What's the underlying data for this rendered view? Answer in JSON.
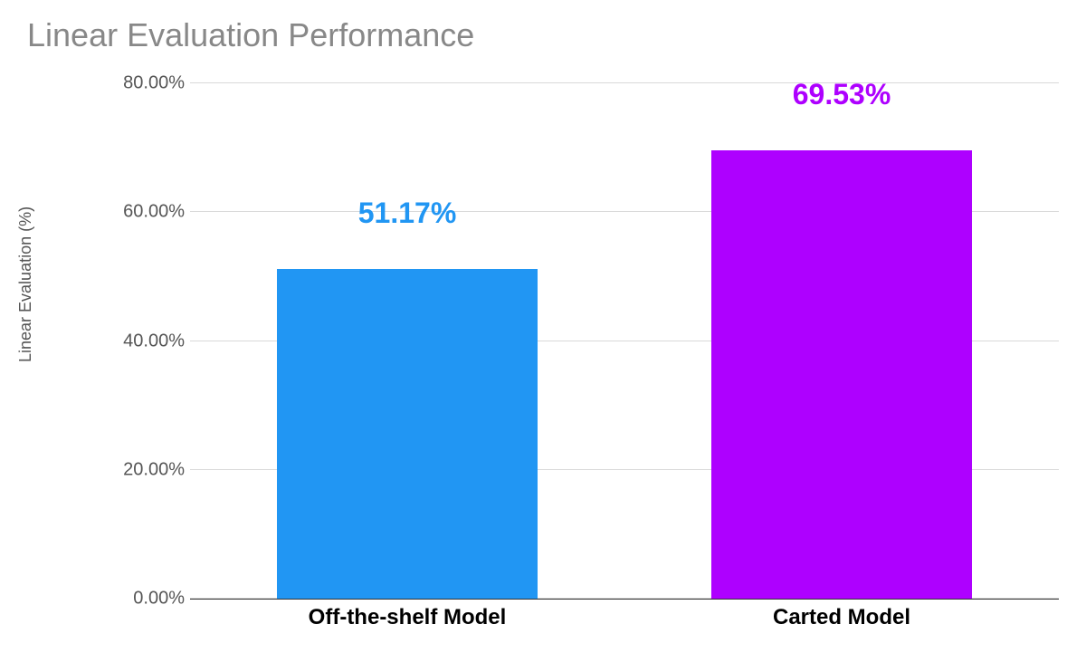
{
  "chart_data": {
    "type": "bar",
    "title": "Linear Evaluation Performance",
    "xlabel": "",
    "ylabel": "Linear Evaluation (%)",
    "categories": [
      "Off-the-shelf Model",
      "Carted Model"
    ],
    "values": [
      51.17,
      69.53
    ],
    "data_labels": [
      "51.17%",
      "69.53%"
    ],
    "ylim": [
      0,
      80
    ],
    "yticks": [
      0,
      20,
      40,
      60,
      80
    ],
    "ytick_labels": [
      "0.00%",
      "20.00%",
      "40.00%",
      "60.00%",
      "80.00%"
    ],
    "colors": [
      "#2196f3",
      "#ae00ff"
    ],
    "grid": true
  }
}
